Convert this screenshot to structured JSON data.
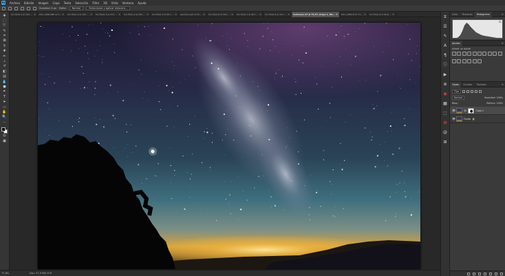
{
  "menu": {
    "items": [
      "Archivo",
      "Edición",
      "Imagen",
      "Capa",
      "Texto",
      "Selección",
      "Filtro",
      "3D",
      "Vista",
      "Ventana",
      "Ayuda"
    ]
  },
  "options": {
    "feather_label": "Suavizar: 0 px",
    "style_label": "Estilo:",
    "style_value": "Normal",
    "select_mask_label": "Seleccionar y aplicar máscara..."
  },
  "tabs": [
    {
      "label": "Sin título-4 al 100% (..."
    },
    {
      "label": "DSC_0084.NEF al 46,7% (..."
    },
    {
      "label": "Sin título-2 al 100% (..."
    },
    {
      "label": "Sin título-3 al 153% (..."
    },
    {
      "label": "Sin título-4 al 200% (..."
    },
    {
      "label": "Sin título-5 al 66,7% (..."
    },
    {
      "label": "Aplicado.psd al 33,3% (Vía..."
    },
    {
      "label": "Sin título-6 al 50% (Ca..."
    },
    {
      "label": "Sin título-7 al 66,7% (Ca..."
    },
    {
      "label": "Sin título-8 al 45,7% (Ca..."
    },
    {
      "label": "Autosave-47 al 73,5% (Capa 1, RGB/16)",
      "active": true
    },
    {
      "label": "DSC_0084.tif al 73,5% (Ca..."
    },
    {
      "label": "Sin título-9 al 90,8% (Ca..."
    }
  ],
  "status": {
    "zoom": "72,8%",
    "doc": "Doc: 57,9 M/0,9 M"
  },
  "panels": {
    "top_tabs": [
      "Color",
      "Muestras",
      "Histograma"
    ],
    "adjust_tab": "Ajustes",
    "adjust_title": "Añadir un ajuste",
    "layer_tabs": [
      "Capas",
      "Canales",
      "Trazados"
    ],
    "kind_label": "Tipo",
    "blend_mode": "Normal",
    "opacity_label": "Opacidad: 100%",
    "lock_label": "Bloq.:",
    "fill_label": "Relleno: 100%",
    "layers": [
      {
        "name": "Capa 1",
        "selected": true
      },
      {
        "name": "Fondo",
        "selected": false
      }
    ]
  },
  "colors": {
    "accent": "#31a8ff",
    "panel_bg": "#3a3a3a",
    "workspace": "#282828"
  }
}
